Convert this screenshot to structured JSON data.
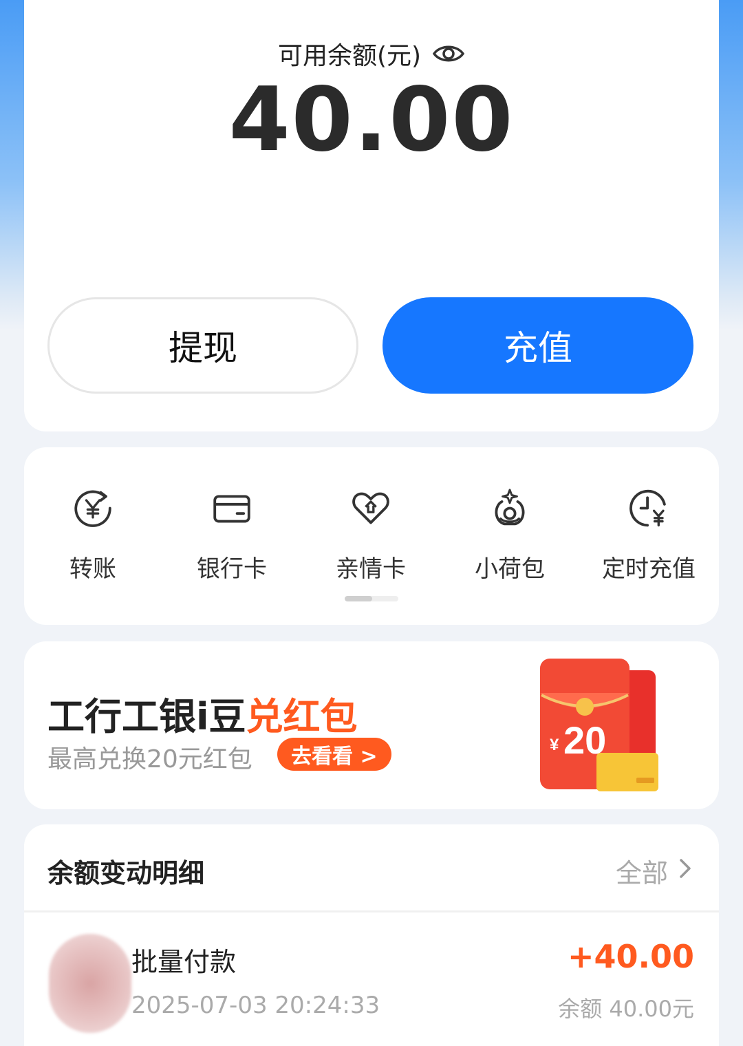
{
  "balance": {
    "label": "可用余额(元)",
    "amount": "40.00"
  },
  "actions": {
    "withdraw_label": "提现",
    "recharge_label": "充值"
  },
  "services": [
    {
      "label": "转账",
      "icon": "transfer-yuan-icon"
    },
    {
      "label": "银行卡",
      "icon": "bank-card-icon"
    },
    {
      "label": "亲情卡",
      "icon": "family-card-icon"
    },
    {
      "label": "小荷包",
      "icon": "small-purse-icon"
    },
    {
      "label": "定时充值",
      "icon": "scheduled-recharge-icon"
    }
  ],
  "promo": {
    "title_main": "工行工银i豆",
    "title_accent": "兑红包",
    "subtitle": "最高兑换20元红包",
    "cta": "去看看 >",
    "graphic_amount": "20",
    "graphic_currency": "¥"
  },
  "transactions": {
    "title": "余额变动明细",
    "all_label": "全部",
    "items": [
      {
        "name": "批量付款",
        "time": "2025-07-03 20:24:33",
        "amount": "+40.00",
        "balance": "余额 40.00元"
      }
    ]
  },
  "colors": {
    "primary": "#1677ff",
    "accent": "#ff5a1f",
    "background": "#f0f3f8"
  }
}
